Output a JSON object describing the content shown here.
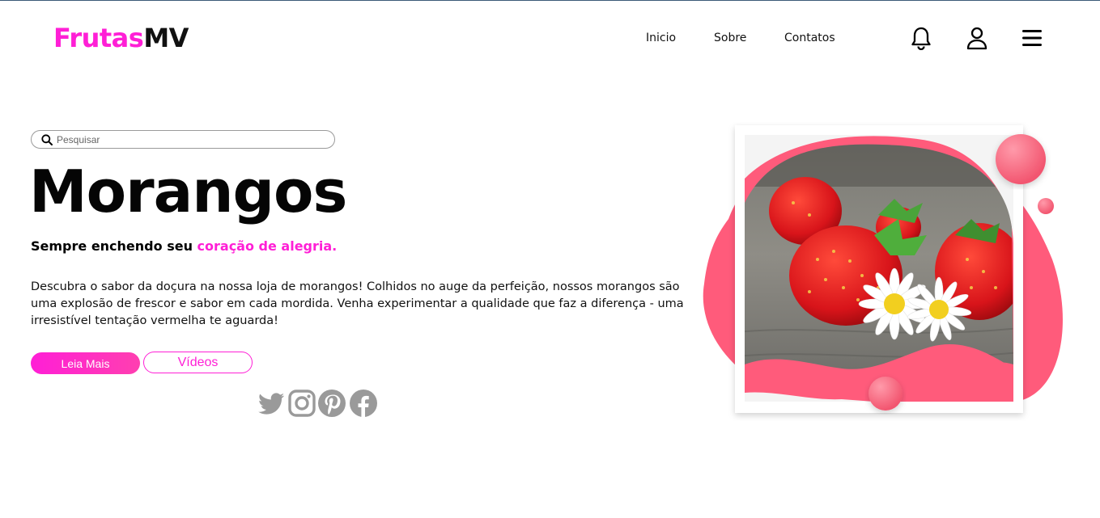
{
  "brand": {
    "part1": "Frutas",
    "part2": "MV",
    "accent": "#ff1fd6"
  },
  "nav": {
    "items": [
      {
        "label": "Inicio"
      },
      {
        "label": "Sobre"
      },
      {
        "label": "Contatos"
      }
    ],
    "icons": [
      "bell-icon",
      "user-icon",
      "menu-icon"
    ]
  },
  "search": {
    "placeholder": "Pesquisar",
    "value": ""
  },
  "hero": {
    "title": "Morangos",
    "subtitle_plain": "Sempre enchendo seu ",
    "subtitle_highlight": "coração de alegria.",
    "description": "Descubra o sabor da doçura na nossa loja de morangos! Colhidos no auge da perfeição, nossos morangos são uma explosão de frescor e sabor em cada mordida. Venha experimentar a qualidade que faz a diferença - uma irresistível tentação vermelha te aguarda!",
    "primary_button": "Leia Mais",
    "secondary_button": "Vídeos"
  },
  "social": [
    "twitter-icon",
    "instagram-icon",
    "pinterest-icon",
    "facebook-icon"
  ],
  "colors": {
    "blob": "#ff5b7b",
    "social": "#9a9a9a"
  }
}
